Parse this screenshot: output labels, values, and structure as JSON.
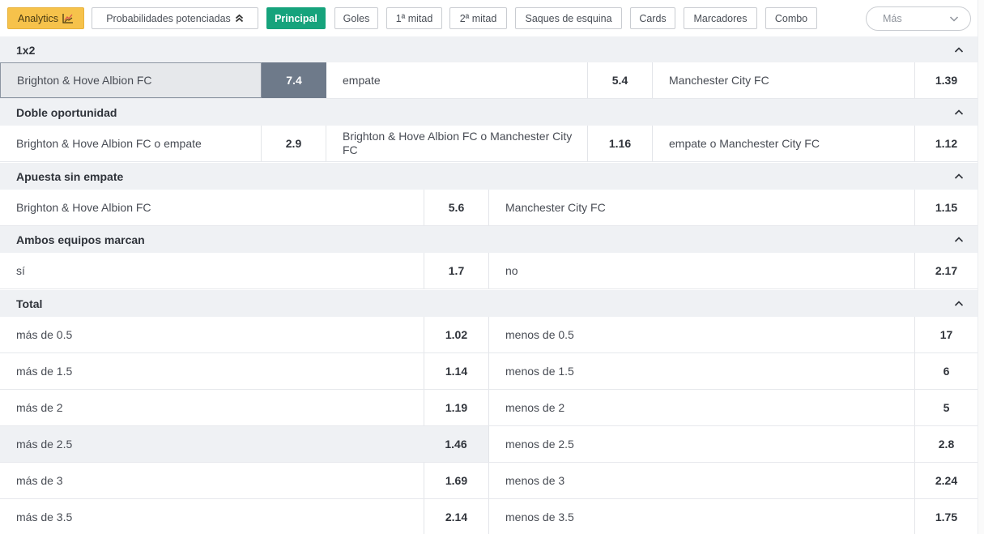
{
  "tabs": {
    "analytics": "Analytics",
    "probabilidades": "Probabilidades potenciadas",
    "principal": "Principal",
    "goles": "Goles",
    "primera_mitad": "1ª mitad",
    "segunda_mitad": "2ª mitad",
    "saques": "Saques de esquina",
    "cards": "Cards",
    "marcadores": "Marcadores",
    "combo": "Combo",
    "mas": "Más"
  },
  "colors": {
    "accent_green": "#16a37c",
    "analytics_yellow": "#f6c24b",
    "selected_odd": "#6e7a8a"
  },
  "markets": {
    "m1x2": {
      "title": "1x2",
      "home": "Brighton & Hove Albion FC",
      "home_odd": "7.4",
      "draw": "empate",
      "draw_odd": "5.4",
      "away": "Manchester City FC",
      "away_odd": "1.39"
    },
    "doble": {
      "title": "Doble oportunidad",
      "a": "Brighton & Hove Albion FC o empate",
      "a_odd": "2.9",
      "b": "Brighton & Hove Albion FC o Manchester City FC",
      "b_odd": "1.16",
      "c": "empate o Manchester City FC",
      "c_odd": "1.12"
    },
    "sin_empate": {
      "title": "Apuesta sin empate",
      "home": "Brighton & Hove Albion FC",
      "home_odd": "5.6",
      "away": "Manchester City FC",
      "away_odd": "1.15"
    },
    "ambos": {
      "title": "Ambos equipos marcan",
      "yes": "sí",
      "yes_odd": "1.7",
      "no": "no",
      "no_odd": "2.17"
    },
    "total": {
      "title": "Total",
      "rows": [
        {
          "over": "más de 0.5",
          "over_odd": "1.02",
          "under": "menos de 0.5",
          "under_odd": "17"
        },
        {
          "over": "más de 1.5",
          "over_odd": "1.14",
          "under": "menos de 1.5",
          "under_odd": "6"
        },
        {
          "over": "más de 2",
          "over_odd": "1.19",
          "under": "menos de 2",
          "under_odd": "5"
        },
        {
          "over": "más de 2.5",
          "over_odd": "1.46",
          "under": "menos de 2.5",
          "under_odd": "2.8"
        },
        {
          "over": "más de 3",
          "over_odd": "1.69",
          "under": "menos de 3",
          "under_odd": "2.24"
        },
        {
          "over": "más de 3.5",
          "over_odd": "2.14",
          "under": "menos de 3.5",
          "under_odd": "1.75"
        }
      ]
    }
  }
}
